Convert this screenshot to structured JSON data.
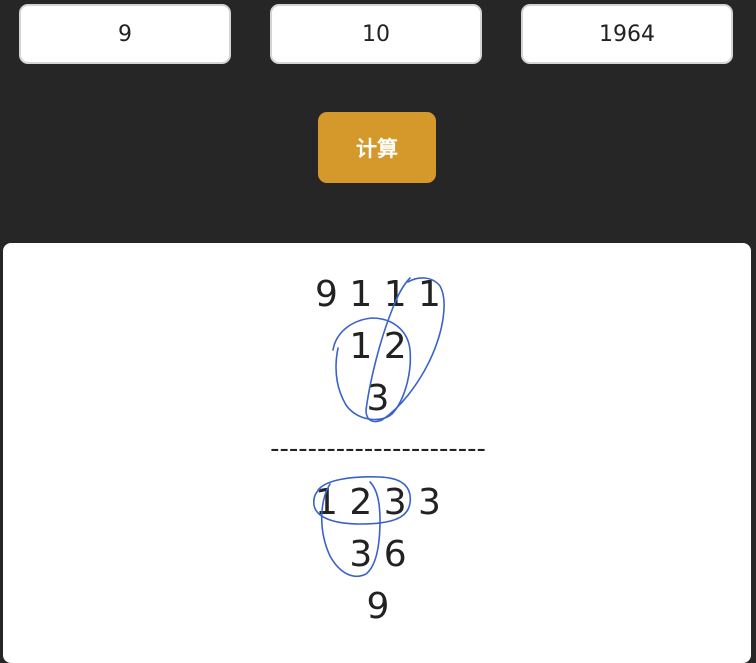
{
  "inputs": {
    "day": "9",
    "month": "10",
    "year": "1964"
  },
  "calculate_button": "计算",
  "result": {
    "top_rows": [
      "9 1 1 1",
      "1 2",
      "3"
    ],
    "divider": "-----------------------",
    "bottom_rows": [
      "1 2 3 3",
      "3 6",
      "9"
    ]
  },
  "colors": {
    "background": "#262626",
    "button": "#d4982b",
    "annotation_ink": "#3a63c9"
  }
}
